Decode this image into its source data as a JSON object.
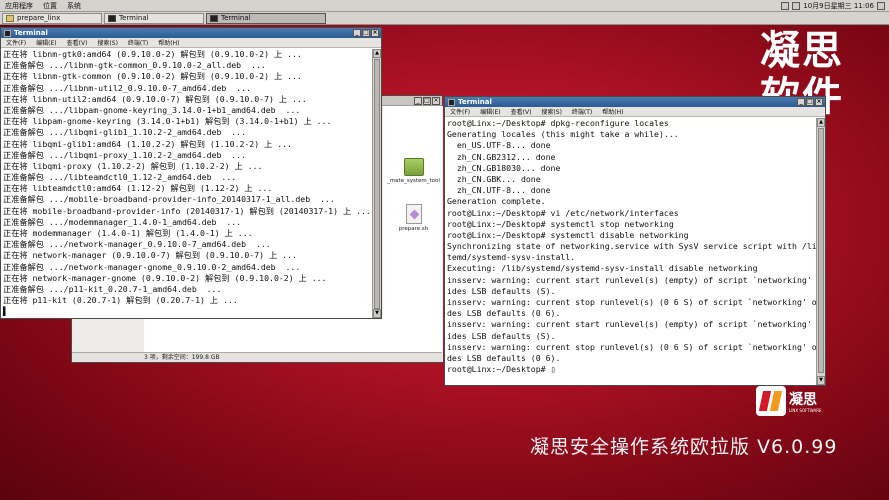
{
  "top_panel": {
    "menus": [
      "应用程序",
      "位置",
      "系统"
    ],
    "clock": "10月9日星期三 11:06"
  },
  "taskbar": {
    "tasks": [
      {
        "label": "prepare_linx",
        "kind": "folder",
        "active": false
      },
      {
        "label": "Terminal",
        "kind": "terminal",
        "active": false
      },
      {
        "label": "Terminal",
        "kind": "terminal",
        "active": true
      }
    ]
  },
  "brand": {
    "big_line1": "凝思",
    "big_line2": "软件",
    "footer": "凝思安全操作系统欧拉版 V6.0.99",
    "logo_text": "凝思",
    "logo_sub": "LINX SOFTWARE"
  },
  "file_manager": {
    "items": [
      {
        "label": "_mate_system_tool",
        "icon": "folder-icon"
      },
      {
        "label": "prepare.sh",
        "icon": "script-file-icon"
      }
    ],
    "status": "3 项，剩余空间：199.8 GB"
  },
  "terminal_left": {
    "title": "Terminal",
    "menu": [
      "文件(F)",
      "编辑(E)",
      "查看(V)",
      "搜索(S)",
      "终端(T)",
      "帮助(H)"
    ],
    "lines": [
      "正在将 libnm-gtk0:amd64 (0.9.10.0-2) 解包到 (0.9.10.0-2) 上 ...",
      "正准备解包 .../libnm-gtk-common_0.9.10.0-2_all.deb  ...",
      "正在将 libnm-gtk-common (0.9.10.0-2) 解包到 (0.9.10.0-2) 上 ...",
      "正准备解包 .../libnm-util2_0.9.10.0-7_amd64.deb  ...",
      "正在将 libnm-util2:amd64 (0.9.10.0-7) 解包到 (0.9.10.0-7) 上 ...",
      "正准备解包 .../libpam-gnome-keyring_3.14.0-1+b1_amd64.deb  ...",
      "正在将 libpam-gnome-keyring (3.14.0-1+b1) 解包到 (3.14.0-1+b1) 上 ...",
      "正准备解包 .../libqmi-glib1_1.10.2-2_amd64.deb  ...",
      "正在将 libqmi-glib1:amd64 (1.10.2-2) 解包到 (1.10.2-2) 上 ...",
      "正准备解包 .../libqmi-proxy_1.10.2-2_amd64.deb  ...",
      "正在将 libqmi-proxy (1.10.2-2) 解包到 (1.10.2-2) 上 ...",
      "正准备解包 .../libteamdctl0_1.12-2_amd64.deb  ...",
      "正在将 libteamdctl0:amd64 (1.12-2) 解包到 (1.12-2) 上 ...",
      "正准备解包 .../mobile-broadband-provider-info_20140317-1_all.deb  ...",
      "正在将 mobile-broadband-provider-info (20140317-1) 解包到 (20140317-1) 上 ...",
      "正准备解包 .../modemmanager_1.4.0-1_amd64.deb  ...",
      "正在将 modemmanager (1.4.0-1) 解包到 (1.4.0-1) 上 ...",
      "正准备解包 .../network-manager_0.9.10.0-7_amd64.deb  ...",
      "正在将 network-manager (0.9.10.0-7) 解包到 (0.9.10.0-7) 上 ...",
      "正准备解包 .../network-manager-gnome_0.9.10.0-2_amd64.deb  ...",
      "正在将 network-manager-gnome (0.9.10.0-2) 解包到 (0.9.10.0-2) 上 ...",
      "正准备解包 .../p11-kit_0.20.7-1_amd64.deb  ...",
      "正在将 p11-kit (0.20.7-1) 解包到 (0.20.7-1) 上 ...",
      "▌"
    ]
  },
  "terminal_right": {
    "title": "Terminal",
    "menu": [
      "文件(F)",
      "编辑(E)",
      "查看(V)",
      "搜索(S)",
      "终端(T)",
      "帮助(H)"
    ],
    "lines": [
      "root@Linx:~/Desktop# dpkg-reconfigure locales",
      "Generating locales (this might take a while)...",
      "  en_US.UTF-8... done",
      "  zh_CN.GB2312... done",
      "  zh_CN.GB18030... done",
      "  zh_CN.GBK... done",
      "  zh_CN.UTF-8... done",
      "Generation complete.",
      "root@Linx:~/Desktop# vi /etc/network/interfaces",
      "root@Linx:~/Desktop# systemctl stop networking",
      "root@Linx:~/Desktop# systemctl disable networking",
      "Synchronizing state of networking.service with SysV service script with /lib/sys",
      "temd/systemd-sysv-install.",
      "Executing: /lib/systemd/systemd-sysv-install disable networking",
      "insserv: warning: current start runlevel(s) (empty) of script `networking' overr",
      "ides LSB defaults (S).",
      "insserv: warning: current stop runlevel(s) (0 6 S) of script `networking' overri",
      "des LSB defaults (0 6).",
      "insserv: warning: current start runlevel(s) (empty) of script `networking' overr",
      "ides LSB defaults (S).",
      "insserv: warning: current stop runlevel(s) (0 6 S) of script `networking' overri",
      "des LSB defaults (0 6).",
      "root@Linx:~/Desktop# ▯"
    ]
  }
}
